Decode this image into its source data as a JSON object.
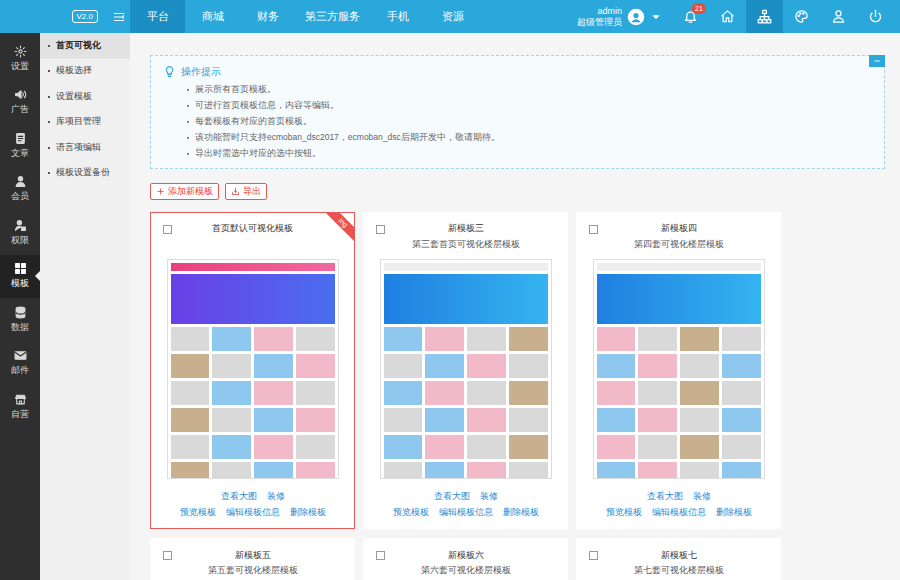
{
  "header": {
    "version": "V2.0",
    "tabs": [
      {
        "label": "平台",
        "selected": true
      },
      {
        "label": "商城",
        "selected": false
      },
      {
        "label": "财务",
        "selected": false
      },
      {
        "label": "第三方服务",
        "selected": false
      },
      {
        "label": "手机",
        "selected": false
      },
      {
        "label": "资源",
        "selected": false
      }
    ],
    "user": {
      "name": "admin",
      "role": "超级管理员"
    },
    "tools": [
      {
        "kind": "bell",
        "badge": "21",
        "selected": false
      },
      {
        "kind": "home",
        "selected": false
      },
      {
        "kind": "sitemap",
        "selected": true
      },
      {
        "kind": "palette",
        "selected": false
      },
      {
        "kind": "admin",
        "selected": false
      },
      {
        "kind": "power",
        "selected": false
      }
    ]
  },
  "sidebar": {
    "items": [
      {
        "label": "设置",
        "kind": "gear",
        "selected": false
      },
      {
        "label": "广告",
        "kind": "ad",
        "selected": false
      },
      {
        "label": "文章",
        "kind": "doc",
        "selected": false
      },
      {
        "label": "会员",
        "kind": "user",
        "selected": false
      },
      {
        "label": "权限",
        "kind": "perm",
        "selected": false
      },
      {
        "label": "模板",
        "kind": "template",
        "selected": true
      },
      {
        "label": "数据",
        "kind": "database",
        "selected": false
      },
      {
        "label": "邮件",
        "kind": "mail",
        "selected": false
      },
      {
        "label": "自营",
        "kind": "store",
        "selected": false
      }
    ]
  },
  "subnav": {
    "items": [
      {
        "label": "首页可视化",
        "selected": true
      },
      {
        "label": "模板选择",
        "selected": false
      },
      {
        "label": "设置模板",
        "selected": false
      },
      {
        "label": "库项目管理",
        "selected": false
      },
      {
        "label": "语言项编辑",
        "selected": false
      },
      {
        "label": "模板设置备份",
        "selected": false
      }
    ]
  },
  "tips": {
    "title": "操作提示",
    "items": [
      "展示所有首页模板。",
      "可进行首页模板信息，内容等编辑。",
      "每套模板有对应的首页模板。",
      "该功能暂时只支持ecmoban_dsc2017，ecmoban_dsc后期开发中，敬请期待。",
      "导出时需选中对应的选中按钮。"
    ]
  },
  "actions": [
    {
      "label": "添加新模板",
      "kind": "add"
    },
    {
      "label": "导出",
      "kind": "export"
    }
  ],
  "templates": [
    {
      "title": "首页默认可视化模板",
      "checked": false,
      "selected": true,
      "ribbon": "ing",
      "links": [
        "查看大图",
        "装修",
        "预览模板",
        "编辑模板信息",
        "删除模板"
      ]
    },
    {
      "title": "新模板三",
      "subtitle": "第三套首页可视化楼层模板",
      "checked": false,
      "selected": false,
      "links": [
        "查看大图",
        "装修",
        "预览模板",
        "编辑模板信息",
        "删除模板"
      ]
    },
    {
      "title": "新模板四",
      "subtitle": "第四套可视化楼层模板",
      "checked": false,
      "selected": false,
      "links": [
        "查看大图",
        "装修",
        "预览模板",
        "编辑模板信息",
        "删除模板"
      ]
    },
    {
      "title": "新模板五",
      "subtitle": "第五套可视化楼层模板",
      "checked": false,
      "selected": false,
      "links": []
    },
    {
      "title": "新模板六",
      "subtitle": "第六套可视化楼层模板",
      "checked": false,
      "selected": false,
      "links": []
    },
    {
      "title": "新模板七",
      "subtitle": "第七套可视化楼层模板",
      "checked": false,
      "selected": false,
      "links": []
    }
  ]
}
